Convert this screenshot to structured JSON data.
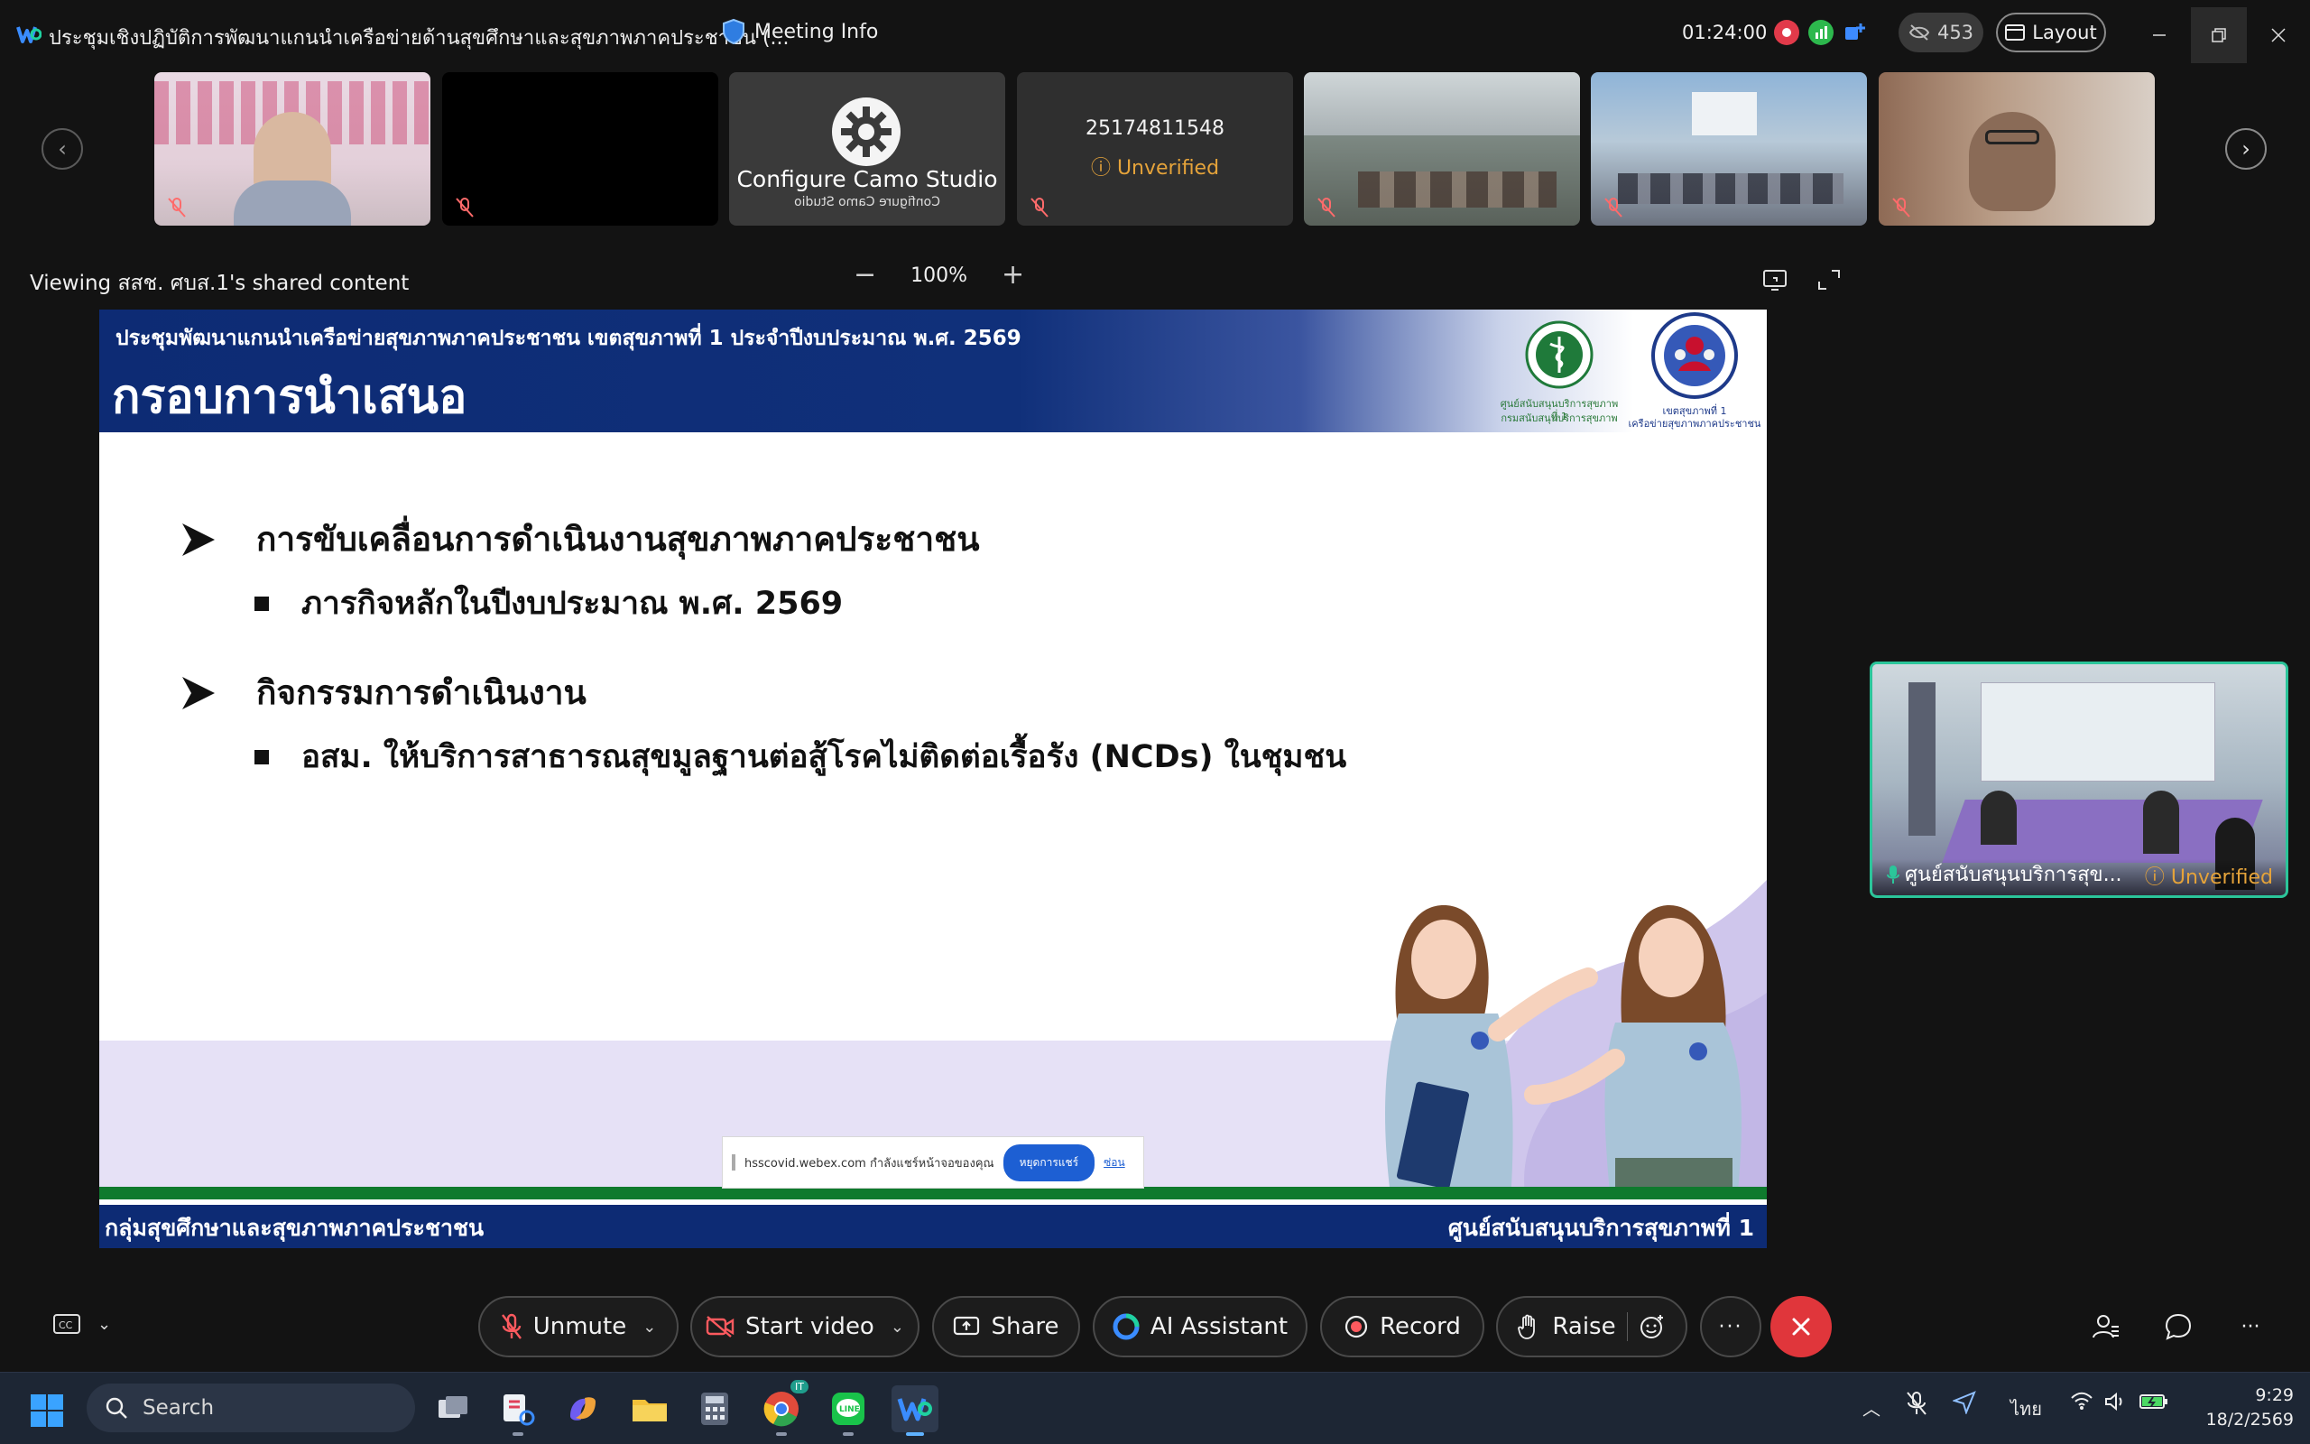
{
  "window": {
    "title": "ประชุมเชิงปฏิบัติการพัฒนาแกนนำเครือข่ายด้านสุขศึกษาและสุขภาพภาคประชาชน (...",
    "meeting_info_label": "Meeting Info",
    "timer": "01:24:00",
    "hidden_count": "453",
    "layout_label": "Layout"
  },
  "strip": {
    "tiles": [
      {
        "kind": "video",
        "muted": true
      },
      {
        "kind": "black",
        "muted": true
      },
      {
        "kind": "app",
        "title": "Configure Camo Studio",
        "mirror": "Configure Camo Studio"
      },
      {
        "kind": "phone",
        "number": "25174811548",
        "status": "Unverified",
        "muted": true
      },
      {
        "kind": "video",
        "muted": true
      },
      {
        "kind": "video",
        "muted": true
      },
      {
        "kind": "video",
        "muted": true
      }
    ]
  },
  "share": {
    "caption": "Viewing สสช. ศบส.1's shared content",
    "zoom": "100%"
  },
  "slide": {
    "subtitle": "ประชุมพัฒนาแกนนำเครือข่ายสุขภาพภาคประชาชน เขตสุขภาพที่ 1 ประจำปีงบประมาณ พ.ศ. 2569",
    "title": "กรอบการนำเสนอ",
    "logo_a_caption_1": "ศูนย์สนับสนุนบริการสุขภาพที่ 1",
    "logo_a_caption_2": "กรมสนับสนุนบริการสุขภาพ",
    "logo_b_caption_1": "เขตสุขภาพที่ 1",
    "logo_b_caption_2": "เครือข่ายสุขภาพภาคประชาชน",
    "sections": [
      {
        "heading": "การขับเคลื่อนการดำเนินงานสุขภาพภาคประชาชน",
        "item": "ภารกิจหลักในปีงบประมาณ พ.ศ. 2569"
      },
      {
        "heading": "กิจกรรมการดำเนินงาน",
        "item": "อสม. ให้บริการสาธารณสุขมูลฐานต่อสู้โรคไม่ติดต่อเรื้อรัง (NCDs) ในชุมชน"
      }
    ],
    "footer_left": "กลุ่มสุขศึกษาและสุขภาพภาคประชาชน",
    "footer_right": "ศูนย์สนับสนุนบริการสุขภาพที่ 1",
    "share_notice": {
      "message": "hsscovid.webex.com กำลังแชร์หน้าจอของคุณ",
      "stop_label": "หยุดการแชร์",
      "hide_label": "ซ่อน"
    }
  },
  "self_view": {
    "name": "ศูนย์สนับสนุนบริการสุข...",
    "status": "Unverified"
  },
  "controls": {
    "unmute": "Unmute",
    "start_video": "Start video",
    "share": "Share",
    "ai_assistant": "AI Assistant",
    "record": "Record",
    "raise": "Raise"
  },
  "taskbar": {
    "search_placeholder": "Search",
    "language": "ไทย",
    "time": "9:29",
    "date": "18/2/2569",
    "chrome_badge": "IT"
  },
  "colors": {
    "accent_teal": "#2bc59a",
    "end_red": "#e0363b",
    "warning": "#e5a33a",
    "slide_navy": "#0d2b74"
  }
}
